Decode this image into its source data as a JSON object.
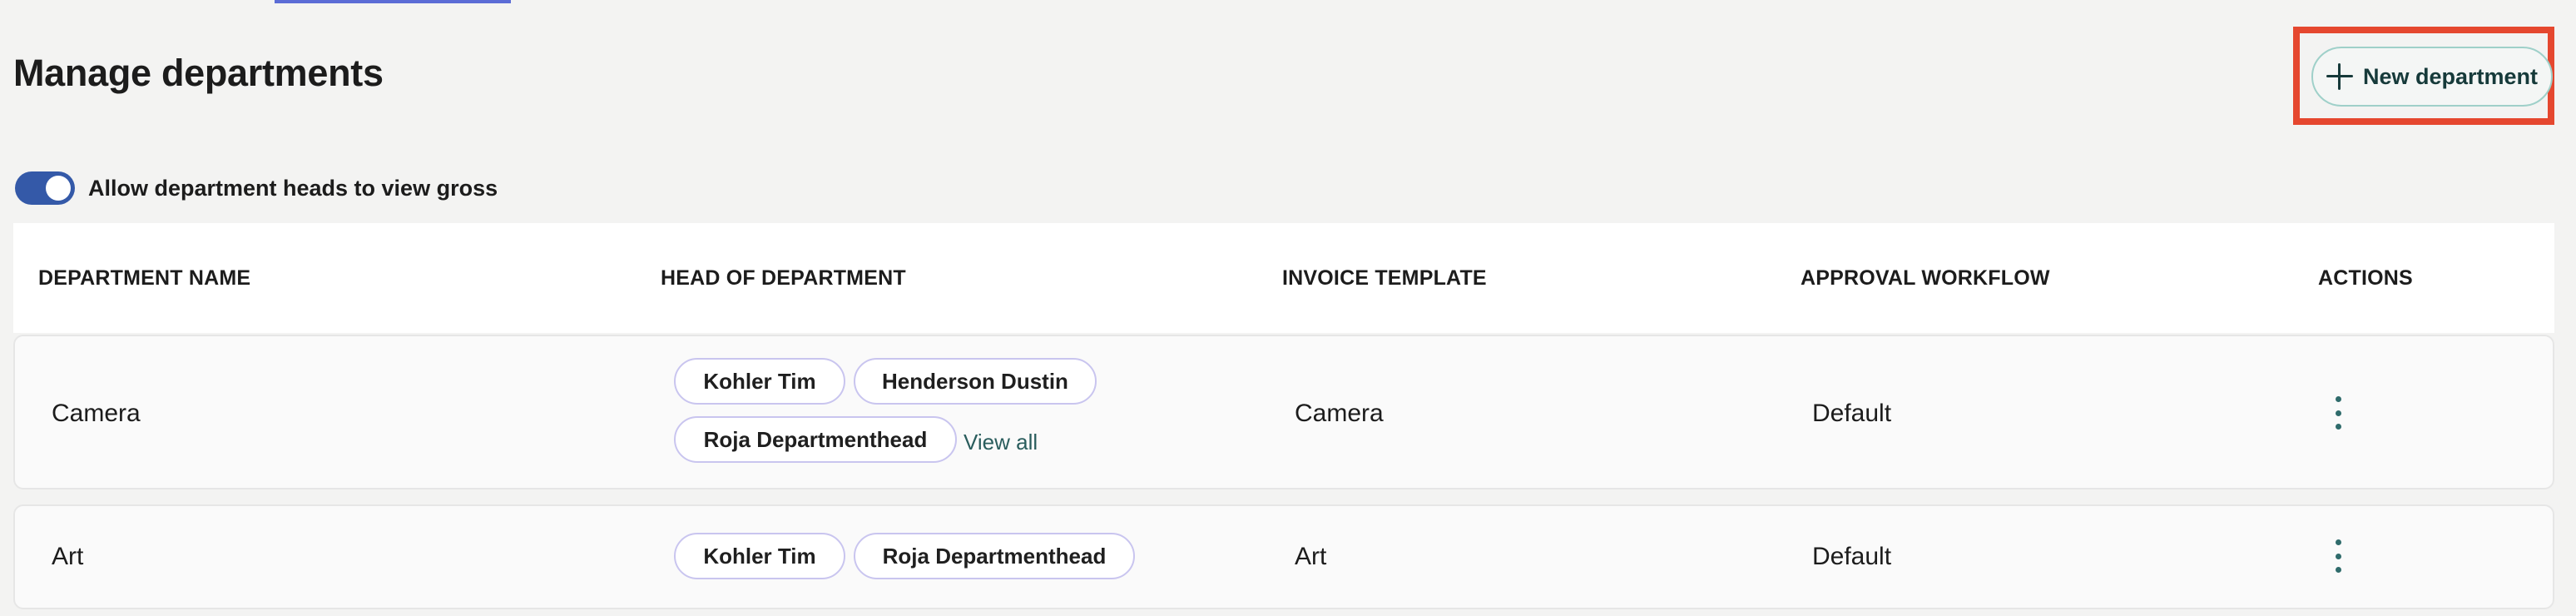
{
  "page": {
    "title": "Manage departments",
    "new_button_label": "New department",
    "toggle_label": "Allow department heads to view gross",
    "toggle_on": true
  },
  "table": {
    "headers": [
      "DEPARTMENT NAME",
      "HEAD OF DEPARTMENT",
      "INVOICE TEMPLATE",
      "APPROVAL WORKFLOW",
      "ACTIONS"
    ],
    "rows": [
      {
        "name": "Camera",
        "heads": [
          "Kohler Tim",
          "Henderson Dustin",
          "Roja Departmenthead"
        ],
        "view_all": "View all",
        "invoice_template": "Camera",
        "approval_workflow": "Default"
      },
      {
        "name": "Art",
        "heads": [
          "Kohler Tim",
          "Roja Departmenthead"
        ],
        "invoice_template": "Art",
        "approval_workflow": "Default"
      }
    ]
  },
  "icons": {
    "add": "plus-icon",
    "row_actions": "kebab-menu-icon"
  },
  "colors": {
    "toggle": "#3459a8",
    "highlight": "#e5472f",
    "chip_border": "#c9c5ef"
  }
}
